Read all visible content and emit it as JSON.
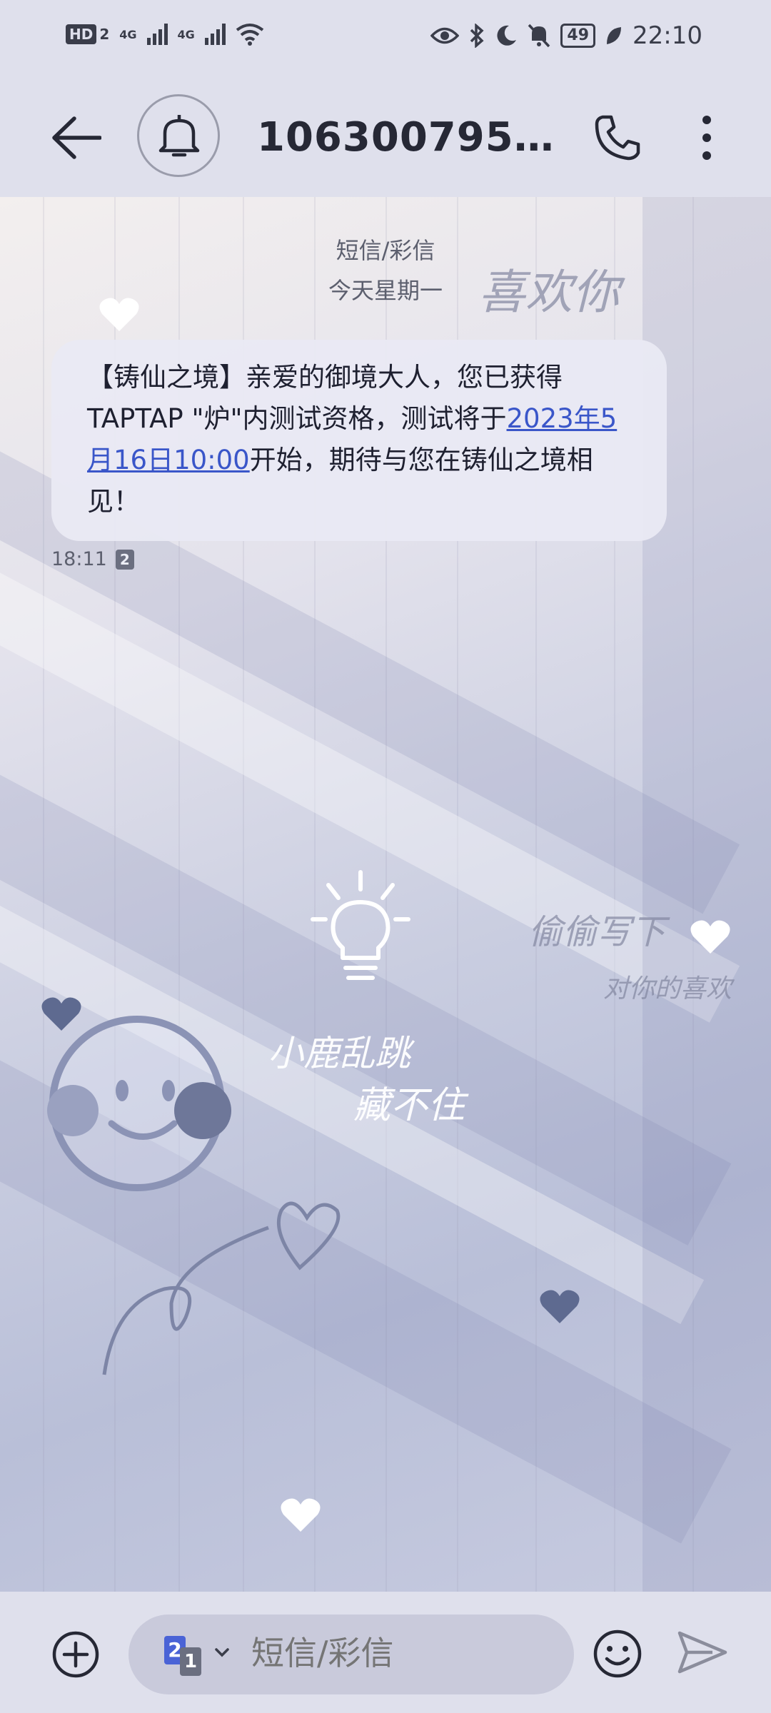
{
  "status_bar": {
    "hd_label": "HD",
    "sim1_label": "2",
    "net1": "4G",
    "net2": "4G",
    "battery": "49",
    "time": "22:10"
  },
  "header": {
    "title": "10630079562…"
  },
  "conversation": {
    "channel_label": "短信/彩信",
    "day_label": "今天星期一",
    "message": {
      "text_before": "【铸仙之境】亲爱的御境大人，您已获得TAPTAP \"炉\"内测试资格，测试将于",
      "link_text": "2023年5月16日10:00",
      "text_after": "开始，期待与您在铸仙之境相见！",
      "time": "18:11",
      "sim": "2"
    },
    "wallpaper_texts": {
      "t1": "喜欢你",
      "t2": "偷偷写下",
      "t3": "对你的喜欢",
      "t4": "小鹿乱跳",
      "t5": "藏不住"
    }
  },
  "composer": {
    "sim_number_front": "2",
    "sim_number_back": "1",
    "placeholder": "短信/彩信"
  },
  "colors": {
    "accent_link": "#3a56c9",
    "bar_bg": "#dfe0ec",
    "bubble_bg": "#e9e9f4"
  }
}
